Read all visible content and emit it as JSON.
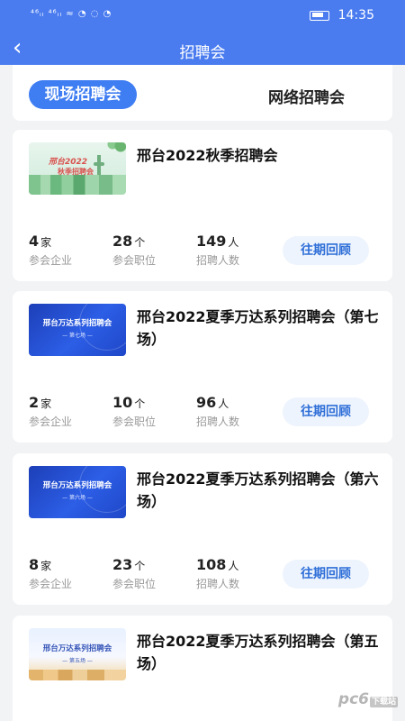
{
  "status_bar": {
    "left_text": "⁴⁶ᵢₗ ⁴⁶ᵢₗ  ≈  ◔  ◌  ◔",
    "time": "14:35"
  },
  "nav": {
    "title": "招聘会",
    "back_icon": "chevron-left-icon"
  },
  "tabs": {
    "active": "现场招聘会",
    "inactive": "网络招聘会"
  },
  "events": [
    {
      "title": "邢台2022秋季招聘会",
      "thumb_line1": "邢台2022",
      "thumb_line2": "秋季招聘会",
      "companies": "4",
      "companies_unit": "家",
      "companies_label": "参会企业",
      "positions": "28",
      "positions_unit": "个",
      "positions_label": "参会职位",
      "hires": "149",
      "hires_unit": "人",
      "hires_label": "招聘人数",
      "button": "往期回顾"
    },
    {
      "title": "邢台2022夏季万达系列招聘会（第七场）",
      "thumb_line1": "邢台万达系列招聘会",
      "thumb_line2": "— 第七场 —",
      "companies": "2",
      "companies_unit": "家",
      "companies_label": "参会企业",
      "positions": "10",
      "positions_unit": "个",
      "positions_label": "参会职位",
      "hires": "96",
      "hires_unit": "人",
      "hires_label": "招聘人数",
      "button": "往期回顾"
    },
    {
      "title": "邢台2022夏季万达系列招聘会（第六场）",
      "thumb_line1": "邢台万达系列招聘会",
      "thumb_line2": "— 第六场 —",
      "companies": "8",
      "companies_unit": "家",
      "companies_label": "参会企业",
      "positions": "23",
      "positions_unit": "个",
      "positions_label": "参会职位",
      "hires": "108",
      "hires_unit": "人",
      "hires_label": "招聘人数",
      "button": "往期回顾"
    },
    {
      "title": "邢台2022夏季万达系列招聘会（第五场）",
      "thumb_line1": "邢台万达系列招聘会",
      "thumb_line2": "— 第五场 —"
    }
  ],
  "watermark": {
    "text": "pc6",
    "badge": "下载站"
  },
  "colors": {
    "primary": "#4a7cf0",
    "tab_active": "#3e7df2",
    "button_bg": "#eef4fd",
    "button_text": "#2f6fd8"
  }
}
